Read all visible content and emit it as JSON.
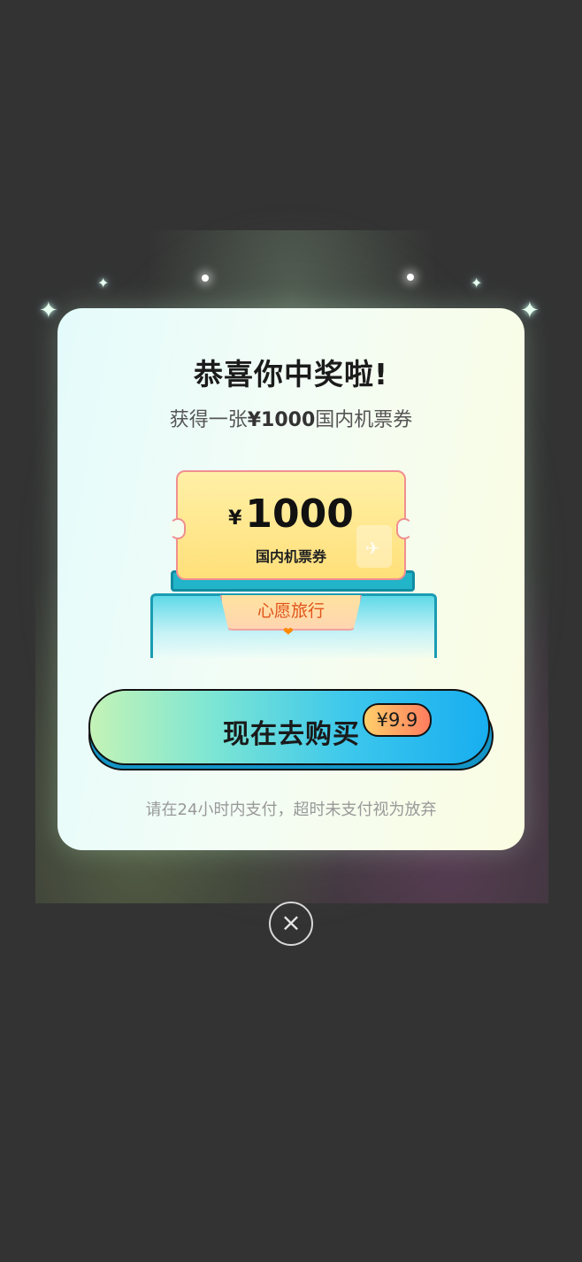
{
  "modal": {
    "title": "恭喜你中奖啦!",
    "subtitle_prefix": "获得一张",
    "subtitle_amount": "¥1000",
    "subtitle_suffix": "国内机票券"
  },
  "ticket": {
    "currency": "¥",
    "amount": "1000",
    "label": "国内机票券",
    "tag": "心愿旅行",
    "icons": [
      "plane-icon",
      "heart-icon"
    ]
  },
  "buy_button": {
    "label": "现在去购买",
    "price": "¥9.9"
  },
  "notice": "请在24小时内支付，超时未支付视为放弃",
  "close_icon": "×",
  "colors": {
    "background": "#333333",
    "button_start": "#c4f3b6",
    "button_end": "#18aef0",
    "badge_start": "#ffd06a",
    "badge_end": "#ff7c5e",
    "ticket": "#ffe07a",
    "tag_text": "#e0531a"
  }
}
